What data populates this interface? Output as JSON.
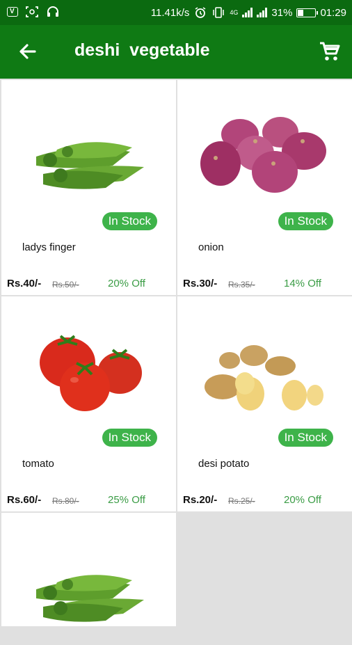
{
  "status_bar": {
    "speed": "11.41k/s",
    "battery": "31%",
    "time": "01:29",
    "network": "4G",
    "battery_level": 0.31
  },
  "app_bar": {
    "title": "deshi  vegetable",
    "back_icon": "arrow-back-icon",
    "cart_icon": "shopping-cart-icon"
  },
  "products": [
    {
      "name": "ladys finger",
      "stock": "In Stock",
      "price": "Rs.40/-",
      "mrp": "Rs.50/-",
      "off": "20% Off",
      "image": "okra"
    },
    {
      "name": "onion",
      "stock": "In Stock",
      "price": "Rs.30/-",
      "mrp": "Rs.35/-",
      "off": "14% Off",
      "image": "onion"
    },
    {
      "name": "tomato",
      "stock": "In Stock",
      "price": "Rs.60/-",
      "mrp": "Rs.80/-",
      "off": "25% Off",
      "image": "tomato"
    },
    {
      "name": "desi potato",
      "stock": "In Stock",
      "price": "Rs.20/-",
      "mrp": "Rs.25/-",
      "off": "20% Off",
      "image": "potato"
    },
    {
      "image": "okra"
    }
  ],
  "colors": {
    "status_bar": "#0b6a10",
    "app_bar": "#0f7a14",
    "badge": "#3eb34a",
    "discount": "#3a9c45",
    "background": "#e0e0e0"
  }
}
